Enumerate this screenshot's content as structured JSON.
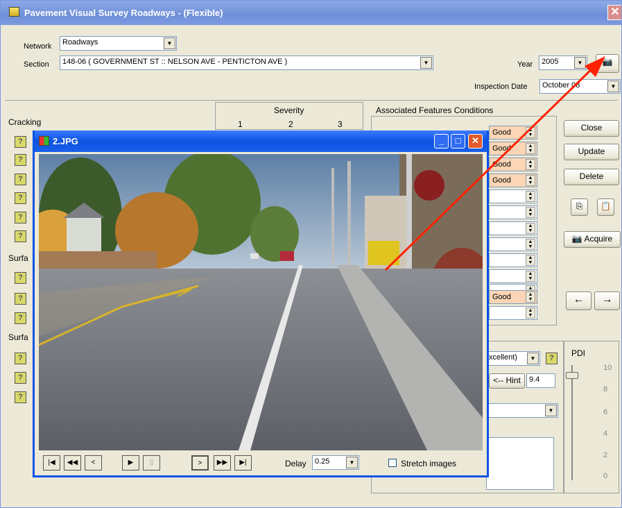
{
  "window": {
    "title": "Pavement Visual Survey Roadways - (Flexible)",
    "close": "✕"
  },
  "form": {
    "network_label": "Network",
    "network_value": "Roadways",
    "section_label": "Section",
    "section_value": "148-06 ( GOVERNMENT ST :: NELSON AVE - PENTICTON AVE )",
    "year_label": "Year",
    "year_value": "2005",
    "inspection_label": "Inspection Date",
    "inspection_value": "October  08"
  },
  "distress": {
    "cracking": "Cracking",
    "surface1": "Surfa",
    "surface2": "Surfa",
    "severity": "Severity",
    "sev": [
      "1",
      "2",
      "3"
    ],
    "hint": "?"
  },
  "features": {
    "title": "Associated Features Conditions",
    "values": [
      "Good",
      "Good",
      "Good",
      "Good",
      "",
      "",
      "",
      "",
      "",
      "",
      "",
      "Good",
      ""
    ]
  },
  "buttons": {
    "close": "Close",
    "update": "Update",
    "delete": "Delete",
    "acquire": "Acquire",
    "left": "←",
    "right": "→"
  },
  "condition": {
    "rating_value": "xcellent)",
    "hint_label": "<-- Hint",
    "hint_value": "9.4"
  },
  "pdi": {
    "label": "PDI",
    "ticks": [
      "10",
      "8",
      "6",
      "4",
      "2",
      "0"
    ],
    "level": 9.4
  },
  "photo_window": {
    "title": "2.JPG",
    "delay_label": "Delay",
    "delay_value": "0.25",
    "stretch_label": "Stretch images",
    "nav": [
      "|◀",
      "◀◀",
      "<",
      "▶",
      "||",
      ">",
      "▶▶",
      "▶|"
    ]
  }
}
